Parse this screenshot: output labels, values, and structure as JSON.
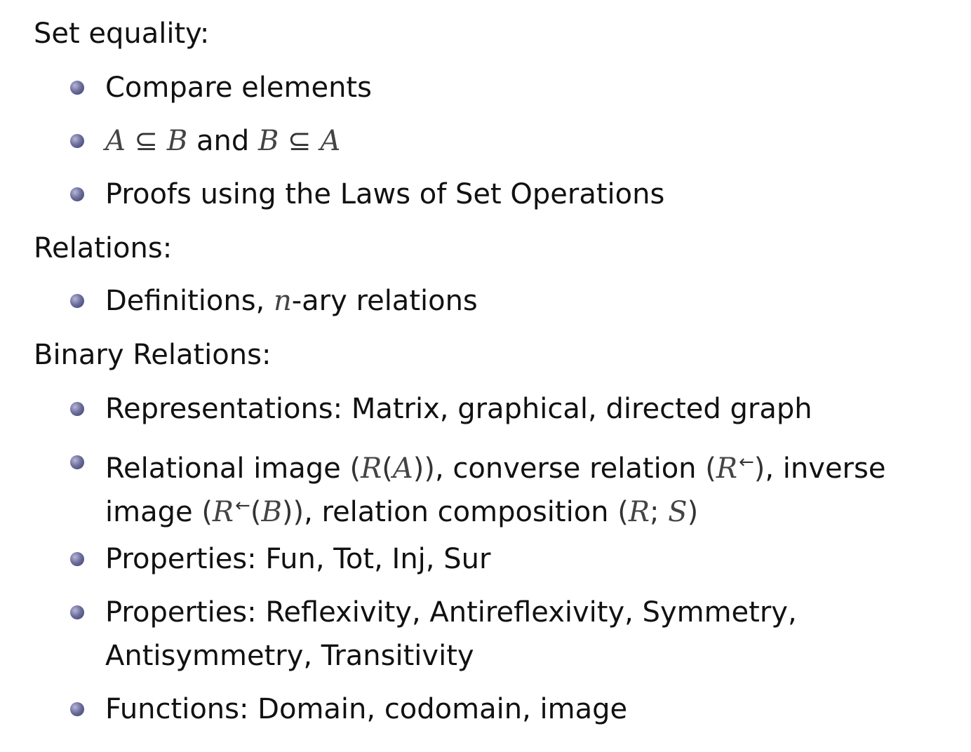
{
  "headings": {
    "set_equality": "Set equality:",
    "relations": "Relations:",
    "binary_relations": "Binary Relations:"
  },
  "set_equality": {
    "compare": "Compare elements",
    "subset_a": "A",
    "subset_sym1": "⊆",
    "subset_b": "B",
    "subset_and": "and",
    "subset_b2": "B",
    "subset_sym2": "⊆",
    "subset_a2": "A",
    "proofs": "Proofs using the Laws of Set Operations"
  },
  "relations": {
    "definitions_pre": "Definitions, ",
    "definitions_n": "n",
    "definitions_post": "-ary relations"
  },
  "binary_relations": {
    "representations": "Representations: Matrix, graphical, directed graph",
    "relational_image_text": "Relational image",
    "r_of_a_open": "(",
    "r_symbol": "R",
    "r_paren_open": "(",
    "a_symbol": "A",
    "r_paren_close": "))",
    "converse_text": ", converse relation",
    "converse_open": "(",
    "converse_r": "R",
    "converse_arrow": "←",
    "converse_close": ")",
    "inverse_text": ", inverse",
    "image_text": "image",
    "inv_open": "(",
    "inv_r": "R",
    "inv_arrow": "←",
    "inv_paren_open": "(",
    "inv_b": "B",
    "inv_close": "))",
    "composition_text": ", relation composition",
    "comp_open": "(",
    "comp_r": "R",
    "comp_semi": ";",
    "comp_s": "S",
    "comp_close": ")",
    "properties_fun": "Properties: Fun, Tot, Inj, Sur",
    "properties_reflex_line1": "Properties: Reflexivity, Antireflexivity, Symmetry,",
    "properties_reflex_line2": "Antisymmetry, Transitivity",
    "functions": "Functions: Domain, codomain, image"
  }
}
